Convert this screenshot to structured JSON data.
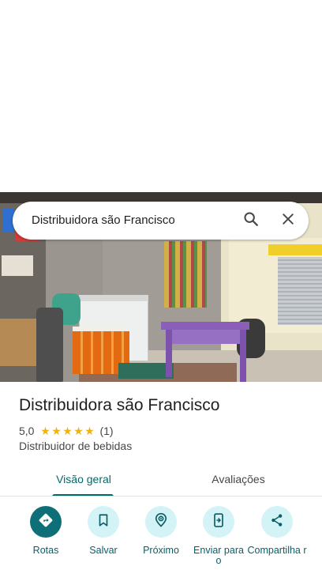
{
  "search": {
    "query": "Distribuidora são Francisco",
    "search_icon": "search-icon",
    "close_icon": "close-icon"
  },
  "place": {
    "name": "Distribuidora são Francisco",
    "rating": "5,0",
    "stars": 5,
    "review_count": "(1)",
    "category": "Distribuidor de bebidas"
  },
  "tabs": [
    {
      "label": "Visão geral",
      "selected": true
    },
    {
      "label": "Avaliações",
      "selected": false
    }
  ],
  "actions": [
    {
      "label": "Rotas",
      "icon": "directions-icon"
    },
    {
      "label": "Salvar",
      "icon": "bookmark-icon"
    },
    {
      "label": "Próximo",
      "icon": "nearby-icon"
    },
    {
      "label": "Enviar para o",
      "icon": "send-to-phone-icon"
    },
    {
      "label": "Compartilha r",
      "icon": "share-icon"
    }
  ],
  "colors": {
    "accent": "#006a6a",
    "primary_button": "#0f6f78",
    "secondary_button_bg": "#d3f3f6",
    "star": "#f2b400"
  }
}
